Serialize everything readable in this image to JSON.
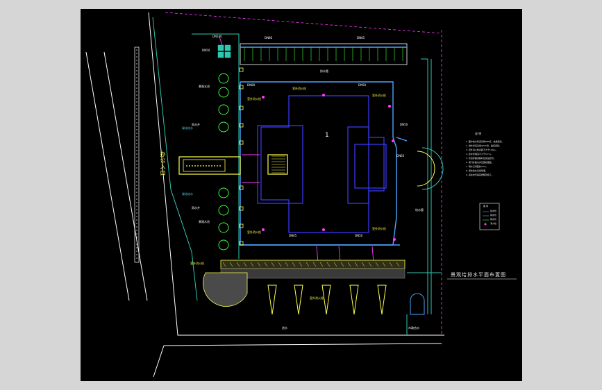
{
  "drawing": {
    "title": "景观给排水平面布置图",
    "building_number": "1",
    "entrance_label": "办公入口"
  },
  "labels": [
    {
      "text": "DN100"
    },
    {
      "text": "DN80"
    },
    {
      "text": "DN65"
    },
    {
      "text": "DN80"
    },
    {
      "text": "DN50"
    },
    {
      "text": "DN65"
    },
    {
      "text": "DN50"
    },
    {
      "text": "DN50"
    },
    {
      "text": "室外消火栓"
    },
    {
      "text": "室外消火栓"
    },
    {
      "text": "室外消火栓"
    },
    {
      "text": "室外消火栓"
    },
    {
      "text": "室外消火栓"
    },
    {
      "text": "绿化给水"
    },
    {
      "text": "绿化给水"
    },
    {
      "text": "景观水池"
    },
    {
      "text": "景观水池"
    },
    {
      "text": "雨水井"
    },
    {
      "text": "雨水井"
    },
    {
      "text": "排水管"
    },
    {
      "text": "DN50"
    },
    {
      "text": "DN65"
    },
    {
      "text": "室外消火栓"
    },
    {
      "text": "室外消火栓"
    },
    {
      "text": "给水管"
    },
    {
      "text": "进水"
    },
    {
      "text": "市政给水"
    }
  ],
  "notes_heading": "说 明",
  "notes": [
    "1. 图中给水管道采用PPR管，热熔连接。",
    "2. 排水管道采用UPVC管，粘接连接。",
    "3. 室外消火栓间距不大于120m。",
    "4. 给水管埋深不小于0.7m。",
    "5. 管道穿越道路时应加设套管。",
    "6. 阀门井做法详见国标图集。",
    "7. 雨水口间距约30m。",
    "8. 绿化给水采用喷灌。",
    "9. 其余未尽事宜按规范施工。"
  ],
  "legend": {
    "heading": "图 例",
    "items": [
      "给水管",
      "排水管",
      "雨水管",
      "消火栓"
    ]
  },
  "colors": {
    "water_supply": "#4aa6ff",
    "building": "#3b3bff",
    "landscape": "#ffff4a",
    "fire": "#ff3cff",
    "drain": "#2fc7b0",
    "green": "#3cff3c",
    "road": "#ffffff"
  }
}
